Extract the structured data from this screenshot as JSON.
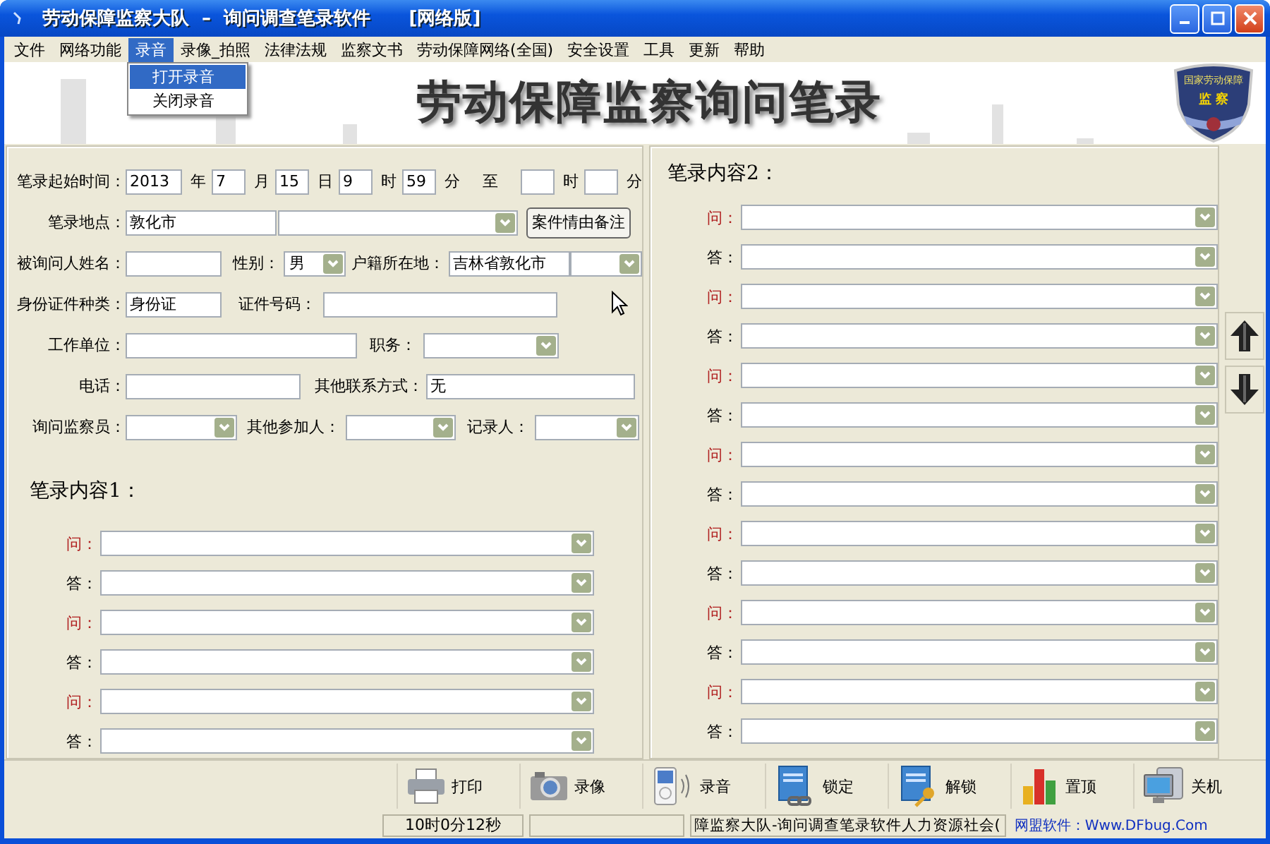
{
  "window": {
    "title": "劳动保障监察大队  –  询问调查笔录软件      [网络版]"
  },
  "menu": [
    {
      "label": "文件",
      "selected": false
    },
    {
      "label": "网络功能",
      "selected": false
    },
    {
      "label": "录音",
      "selected": true
    },
    {
      "label": "录像_拍照",
      "selected": false
    },
    {
      "label": "法律法规",
      "selected": false
    },
    {
      "label": "监察文书",
      "selected": false
    },
    {
      "label": "劳动保障网络(全国)",
      "selected": false
    },
    {
      "label": "安全设置",
      "selected": false
    },
    {
      "label": "工具",
      "selected": false
    },
    {
      "label": "更新",
      "selected": false
    },
    {
      "label": "帮助",
      "selected": false
    }
  ],
  "menu_dropdown": [
    {
      "label": "打开录音",
      "selected": true
    },
    {
      "label": "关闭录音",
      "selected": false
    }
  ],
  "header": {
    "title": "劳动保障监察询问笔录",
    "emblem_top": "国家劳动保障",
    "emblem_text": "监 察"
  },
  "form_rows": [
    [
      {
        "kind": "label",
        "text": "笔录起始时间："
      },
      {
        "kind": "input",
        "value": "2013"
      },
      {
        "kind": "label",
        "text": "年"
      },
      {
        "kind": "input",
        "value": "7"
      },
      {
        "kind": "label",
        "text": "月"
      },
      {
        "kind": "input",
        "value": "15"
      },
      {
        "kind": "label",
        "text": "日"
      },
      {
        "kind": "input",
        "value": "9"
      },
      {
        "kind": "label",
        "text": "时"
      },
      {
        "kind": "input",
        "value": "59"
      },
      {
        "kind": "label",
        "text": "分"
      },
      {
        "kind": "label",
        "text": "至"
      },
      {
        "kind": "input"
      },
      {
        "kind": "label",
        "text": "时"
      },
      {
        "kind": "input"
      },
      {
        "kind": "label",
        "text": "分"
      }
    ],
    [
      {
        "kind": "label",
        "text": "笔录地点："
      },
      {
        "kind": "input",
        "value": "敦化市"
      },
      {
        "kind": "combo"
      },
      {
        "kind": "button",
        "text": "案件情由备注"
      }
    ],
    [
      {
        "kind": "label",
        "text": "被询问人姓名："
      },
      {
        "kind": "input"
      },
      {
        "kind": "label",
        "text": "性别："
      },
      {
        "kind": "combo",
        "value": "男"
      },
      {
        "kind": "label",
        "text": "户籍所在地："
      },
      {
        "kind": "input",
        "value": "吉林省敦化市"
      },
      {
        "kind": "combo"
      }
    ],
    [
      {
        "kind": "label",
        "text": "身份证件种类："
      },
      {
        "kind": "input",
        "value": "身份证"
      },
      {
        "kind": "label",
        "text": "证件号码："
      },
      {
        "kind": "input"
      }
    ],
    [
      {
        "kind": "label",
        "text": "工作单位："
      },
      {
        "kind": "input"
      },
      {
        "kind": "label",
        "text": "职务："
      },
      {
        "kind": "combo"
      }
    ],
    [
      {
        "kind": "label",
        "text": "电话："
      },
      {
        "kind": "input"
      },
      {
        "kind": "label",
        "text": "其他联系方式："
      },
      {
        "kind": "input",
        "value": "无"
      }
    ],
    [
      {
        "kind": "label",
        "text": "询问监察员："
      },
      {
        "kind": "combo"
      },
      {
        "kind": "label",
        "text": "其他参加人："
      },
      {
        "kind": "combo"
      },
      {
        "kind": "label",
        "text": "记录人："
      },
      {
        "kind": "combo"
      }
    ]
  ],
  "content1": {
    "heading": "笔录内容1：",
    "rows": [
      {
        "kind": "question",
        "label": "问："
      },
      {
        "kind": "answer",
        "label": "答："
      },
      {
        "kind": "question",
        "label": "问："
      },
      {
        "kind": "answer",
        "label": "答："
      },
      {
        "kind": "question",
        "label": "问："
      },
      {
        "kind": "answer",
        "label": "答："
      }
    ]
  },
  "content2": {
    "heading": "笔录内容2：",
    "rows": [
      {
        "kind": "question",
        "label": "问："
      },
      {
        "kind": "answer",
        "label": "答："
      },
      {
        "kind": "question",
        "label": "问："
      },
      {
        "kind": "answer",
        "label": "答："
      },
      {
        "kind": "question",
        "label": "问："
      },
      {
        "kind": "answer",
        "label": "答："
      },
      {
        "kind": "question",
        "label": "问："
      },
      {
        "kind": "answer",
        "label": "答："
      },
      {
        "kind": "question",
        "label": "问："
      },
      {
        "kind": "answer",
        "label": "答："
      },
      {
        "kind": "question",
        "label": "问："
      },
      {
        "kind": "answer",
        "label": "答："
      },
      {
        "kind": "question",
        "label": "问："
      },
      {
        "kind": "answer",
        "label": "答："
      }
    ]
  },
  "toolbar": [
    {
      "label": "打印"
    },
    {
      "label": "录像"
    },
    {
      "label": "录音"
    },
    {
      "label": "锁定"
    },
    {
      "label": "解锁"
    },
    {
      "label": "置顶"
    },
    {
      "label": "关机"
    }
  ],
  "status_bar": {
    "timer": "10时0分12秒",
    "marquee": "障监察大队-询问调查笔录软件人力资源社会(",
    "link": "网盟软件：Www.DFbug.Com"
  }
}
